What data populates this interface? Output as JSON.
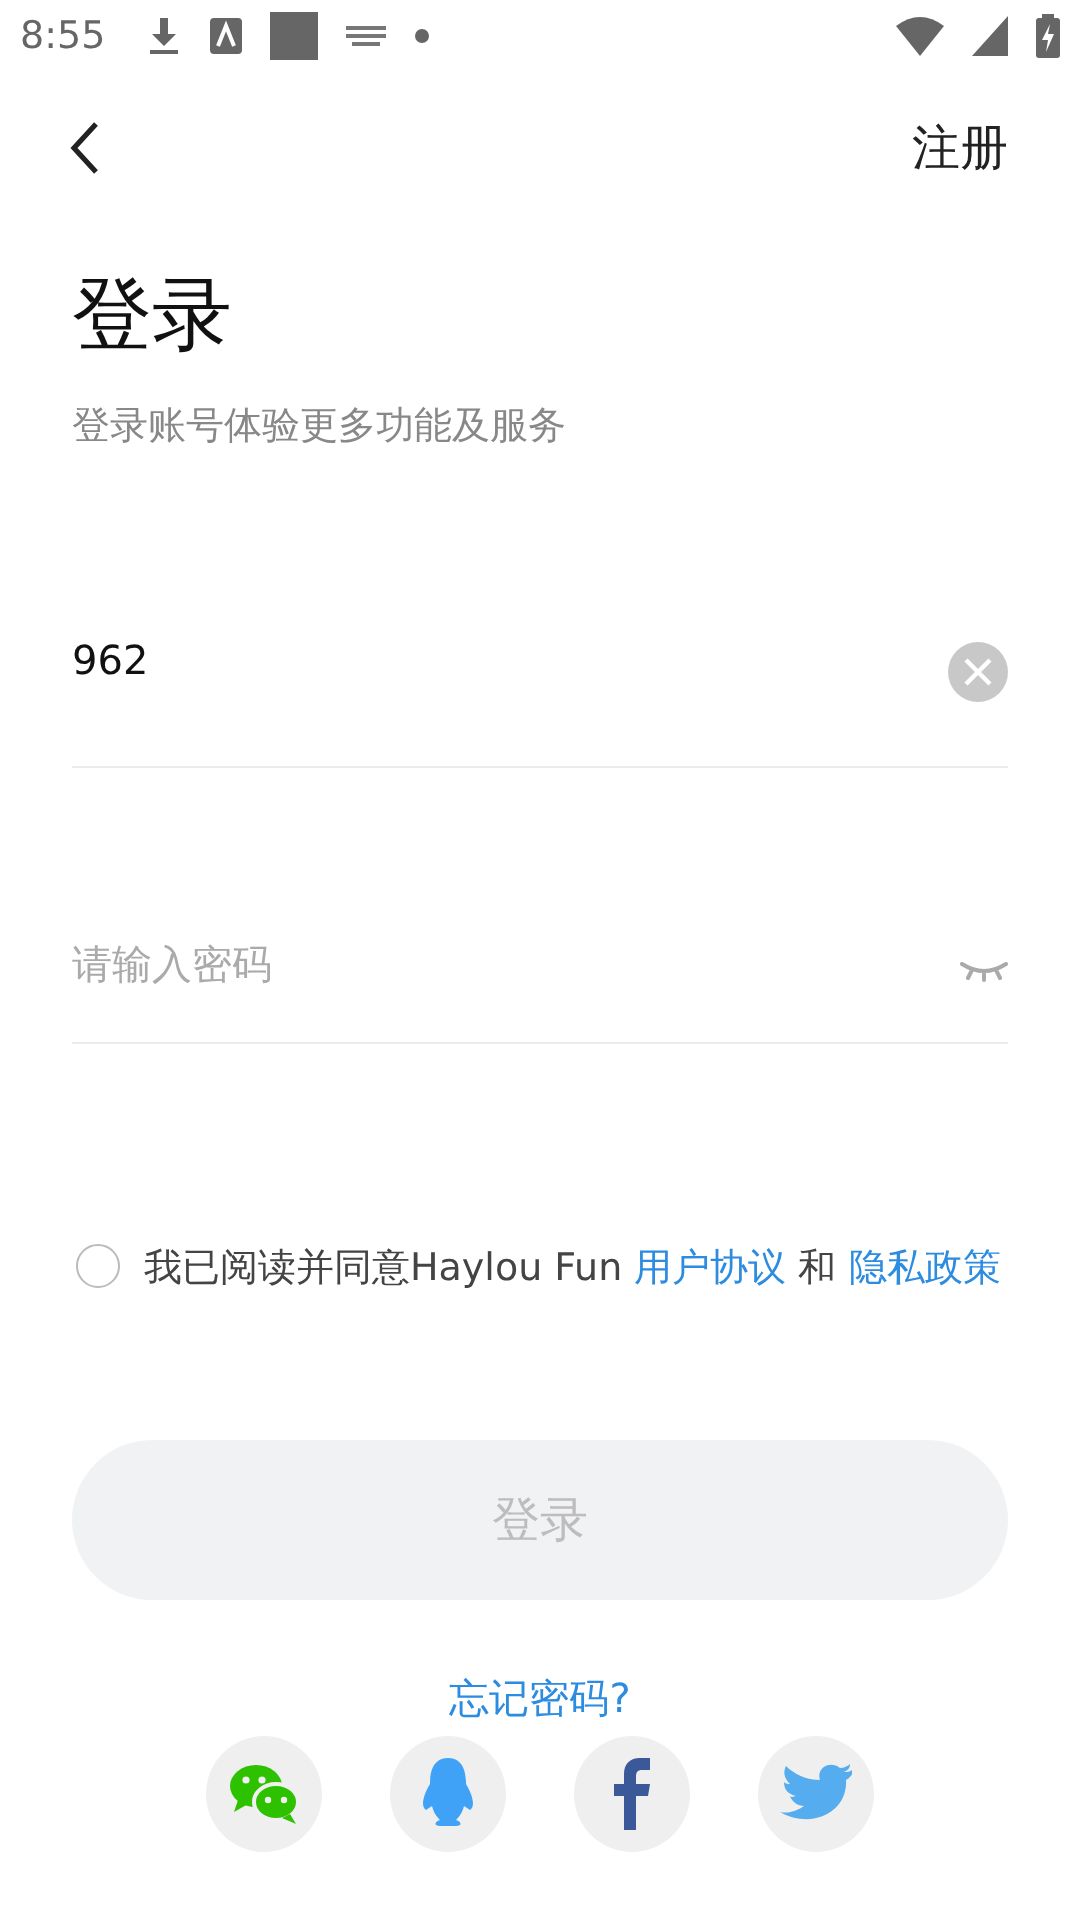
{
  "status_bar": {
    "time": "8:55"
  },
  "header": {
    "action": "注册"
  },
  "title": "登录",
  "subtitle": "登录账号体验更多功能及服务",
  "fields": [
    {
      "kind": "account",
      "value": "962"
    },
    {
      "kind": "password",
      "placeholder": "请输入密码"
    }
  ],
  "agreement": {
    "checked": false,
    "parts": [
      {
        "kind": "text",
        "text": "我已阅读并同意Haylou Fun "
      },
      {
        "kind": "link",
        "text": "用户协议"
      },
      {
        "kind": "text",
        "text": " 和 "
      },
      {
        "kind": "link",
        "text": "隐私政策"
      }
    ]
  },
  "login_button": {
    "label": "登录",
    "disabled": true
  },
  "forgot_link": "忘记密码?",
  "social": [
    {
      "kind": "wechat"
    },
    {
      "kind": "qq"
    },
    {
      "kind": "facebook"
    },
    {
      "kind": "twitter"
    }
  ]
}
